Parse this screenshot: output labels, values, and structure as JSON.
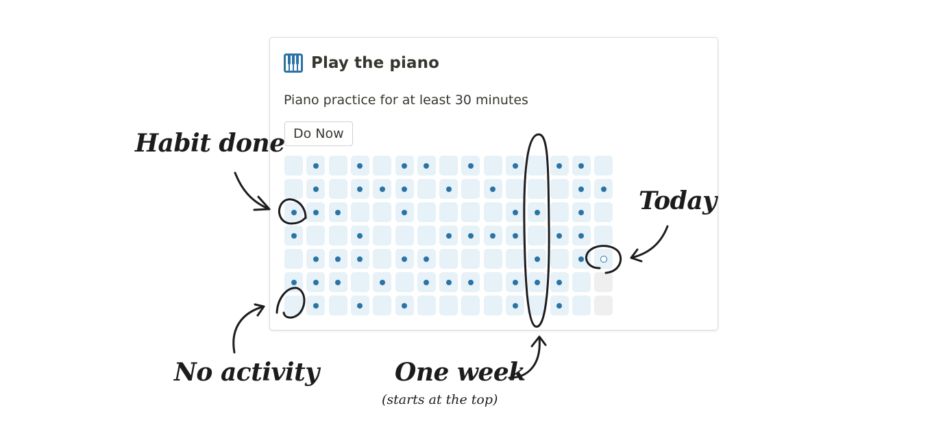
{
  "habit": {
    "title": "Play the piano",
    "description": "Piano practice for at least 30 minutes",
    "button_label": "Do Now",
    "icon": "piano-icon",
    "accent_color": "#2b73a5",
    "cell_color": "#e6f1f8",
    "empty_cell_color": "#efefef"
  },
  "grid": {
    "weeks": 15,
    "days_per_week": 7,
    "today": {
      "week": 14,
      "day": 4
    },
    "future_cells": [
      {
        "week": 14,
        "day": 5
      },
      {
        "week": 14,
        "day": 6
      }
    ],
    "done": [
      [
        0,
        1,
        0,
        1,
        0,
        1,
        1,
        0,
        1,
        0,
        1,
        0,
        1,
        1,
        0
      ],
      [
        0,
        1,
        0,
        1,
        1,
        1,
        0,
        1,
        0,
        1,
        0,
        0,
        0,
        1,
        1
      ],
      [
        1,
        1,
        1,
        0,
        0,
        1,
        0,
        0,
        0,
        0,
        1,
        1,
        0,
        1,
        0
      ],
      [
        1,
        0,
        0,
        1,
        0,
        0,
        0,
        1,
        1,
        1,
        1,
        0,
        1,
        1,
        0
      ],
      [
        0,
        1,
        1,
        1,
        0,
        1,
        1,
        0,
        0,
        0,
        0,
        1,
        0,
        1,
        0
      ],
      [
        1,
        1,
        1,
        0,
        1,
        0,
        1,
        1,
        1,
        0,
        1,
        1,
        1,
        0,
        0
      ],
      [
        0,
        1,
        0,
        1,
        0,
        1,
        0,
        0,
        0,
        0,
        1,
        0,
        1,
        0,
        0
      ]
    ]
  },
  "annotations": {
    "habit_done": "Habit done",
    "today": "Today",
    "no_activity": "No activity",
    "one_week": "One week",
    "one_week_note": "(starts at the top)"
  }
}
